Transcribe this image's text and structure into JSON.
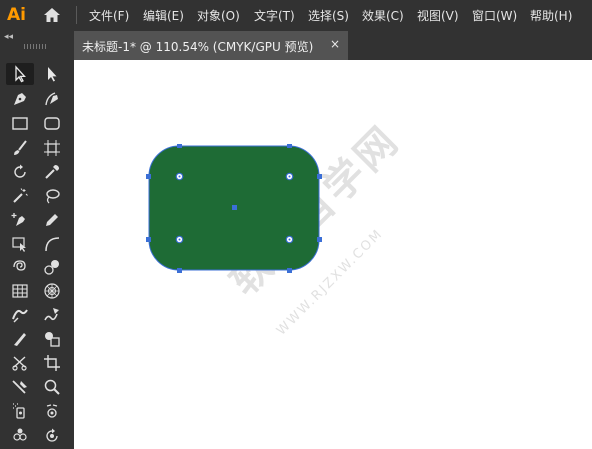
{
  "app": {
    "logo_text": "Ai",
    "accent_color": "#ff9a00"
  },
  "menu": {
    "items": [
      "文件(F)",
      "编辑(E)",
      "对象(O)",
      "文字(T)",
      "选择(S)",
      "效果(C)",
      "视图(V)",
      "窗口(W)",
      "帮助(H)"
    ]
  },
  "panel": {
    "collapse_glyph": "◂◂"
  },
  "document_tab": {
    "title": "未标题-1* @ 110.54% (CMYK/GPU 预览)",
    "close_glyph": "×"
  },
  "canvas": {
    "background": "#ffffff",
    "shape": {
      "type": "rounded-rectangle",
      "fill_color": "#1e6b35",
      "stroke_color": "#3b6fd6",
      "selected": true
    },
    "watermark_text": "软件自学网",
    "watermark_sub": "WWW.RJZXW.COM"
  },
  "tools": [
    "selection-tool-icon",
    "direct-selection-tool-icon",
    "pen-tool-icon",
    "curvature-tool-icon",
    "rectangle-tool-icon",
    "rounded-rectangle-tool-icon",
    "paintbrush-tool-icon",
    "artboard-tool-icon",
    "rotate-tool-icon",
    "eyedropper-tool-icon",
    "magic-wand-tool-icon",
    "lasso-tool-icon",
    "anchor-add-tool-icon",
    "pencil-tool-icon",
    "free-transform-tool-icon",
    "arc-tool-icon",
    "spiral-tool-icon",
    "blend-tool-icon",
    "grid-tool-icon",
    "polar-grid-tool-icon",
    "width-tool-icon",
    "warp-tool-icon",
    "knife-tool-icon",
    "shape-builder-tool-icon",
    "scissors-tool-icon",
    "crop-tool-icon",
    "slice-tool-icon",
    "zoom-tool-icon",
    "symbol-sprayer-tool-icon",
    "symbol-shifter-tool-icon",
    "symbol-scruncher-tool-icon",
    "symbol-spinner-tool-icon"
  ]
}
